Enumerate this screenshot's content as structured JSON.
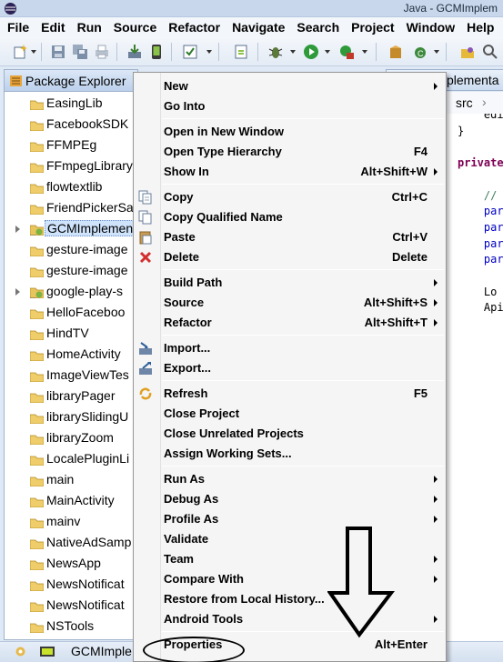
{
  "window": {
    "title": "Java - GCMImplem"
  },
  "menubar": [
    "File",
    "Edit",
    "Run",
    "Source",
    "Refactor",
    "Navigate",
    "Search",
    "Project",
    "Window",
    "Help"
  ],
  "package_explorer": {
    "tab_title": "Package Explorer",
    "items": [
      {
        "label": "EasingLib",
        "kind": "folder",
        "expandable": false
      },
      {
        "label": "FacebookSDK",
        "kind": "folder",
        "expandable": false
      },
      {
        "label": "FFMPEg",
        "kind": "folder",
        "expandable": false
      },
      {
        "label": "FFmpegLibrary",
        "kind": "folder",
        "expandable": false
      },
      {
        "label": "flowtextlib",
        "kind": "folder",
        "expandable": false
      },
      {
        "label": "FriendPickerSa",
        "kind": "folder",
        "expandable": false
      },
      {
        "label": "GCMImplemen",
        "kind": "project",
        "expandable": true,
        "selected": true
      },
      {
        "label": "gesture-image",
        "kind": "folder",
        "expandable": false
      },
      {
        "label": "gesture-image",
        "kind": "folder",
        "expandable": false
      },
      {
        "label": "google-play-s",
        "kind": "project",
        "expandable": true
      },
      {
        "label": "HelloFaceboo",
        "kind": "folder",
        "expandable": false
      },
      {
        "label": "HindTV",
        "kind": "folder",
        "expandable": false
      },
      {
        "label": "HomeActivity",
        "kind": "folder",
        "expandable": false
      },
      {
        "label": "ImageViewTes",
        "kind": "folder",
        "expandable": false
      },
      {
        "label": "libraryPager",
        "kind": "folder",
        "expandable": false
      },
      {
        "label": "librarySlidingU",
        "kind": "folder",
        "expandable": false
      },
      {
        "label": "libraryZoom",
        "kind": "folder",
        "expandable": false
      },
      {
        "label": "LocalePluginLi",
        "kind": "folder",
        "expandable": false
      },
      {
        "label": "main",
        "kind": "folder",
        "expandable": false
      },
      {
        "label": "MainActivity",
        "kind": "folder",
        "expandable": false
      },
      {
        "label": "mainv",
        "kind": "folder",
        "expandable": false
      },
      {
        "label": "NativeAdSamp",
        "kind": "folder",
        "expandable": false
      },
      {
        "label": "NewsApp",
        "kind": "folder",
        "expandable": false
      },
      {
        "label": "NewsNotificat",
        "kind": "folder",
        "expandable": false
      },
      {
        "label": "NewsNotificat",
        "kind": "folder",
        "expandable": false
      },
      {
        "label": "NSTools",
        "kind": "folder",
        "expandable": false
      }
    ]
  },
  "editor": {
    "tab_title": "plementa",
    "breadcrumb_src": "src",
    "breadcrumb_sep": "›",
    "code_lines": [
      "    edi",
      "}",
      "",
      "private",
      "",
      "    //",
      "    par",
      "    par",
      "    par",
      "    par",
      "",
      "    Lo",
      "    Api"
    ]
  },
  "status": {
    "text": "GCMImple"
  },
  "context_menu": {
    "items": [
      {
        "label": "New",
        "shortcut": "",
        "submenu": true,
        "icon": ""
      },
      {
        "label": "Go Into",
        "shortcut": "",
        "submenu": false,
        "icon": ""
      },
      {
        "sep": true
      },
      {
        "label": "Open in New Window",
        "shortcut": "",
        "submenu": false,
        "icon": ""
      },
      {
        "label": "Open Type Hierarchy",
        "shortcut": "F4",
        "submenu": false,
        "icon": ""
      },
      {
        "label": "Show In",
        "shortcut": "Alt+Shift+W",
        "submenu": true,
        "icon": ""
      },
      {
        "sep": true
      },
      {
        "label": "Copy",
        "shortcut": "Ctrl+C",
        "submenu": false,
        "icon": "copy-icon"
      },
      {
        "label": "Copy Qualified Name",
        "shortcut": "",
        "submenu": false,
        "icon": "copy-qualified-icon"
      },
      {
        "label": "Paste",
        "shortcut": "Ctrl+V",
        "submenu": false,
        "icon": "paste-icon"
      },
      {
        "label": "Delete",
        "shortcut": "Delete",
        "submenu": false,
        "icon": "delete-icon"
      },
      {
        "sep": true
      },
      {
        "label": "Build Path",
        "shortcut": "",
        "submenu": true,
        "icon": ""
      },
      {
        "label": "Source",
        "shortcut": "Alt+Shift+S",
        "submenu": true,
        "icon": ""
      },
      {
        "label": "Refactor",
        "shortcut": "Alt+Shift+T",
        "submenu": true,
        "icon": ""
      },
      {
        "sep": true
      },
      {
        "label": "Import...",
        "shortcut": "",
        "submenu": false,
        "icon": "import-icon"
      },
      {
        "label": "Export...",
        "shortcut": "",
        "submenu": false,
        "icon": "export-icon"
      },
      {
        "sep": true
      },
      {
        "label": "Refresh",
        "shortcut": "F5",
        "submenu": false,
        "icon": "refresh-icon"
      },
      {
        "label": "Close Project",
        "shortcut": "",
        "submenu": false,
        "icon": ""
      },
      {
        "label": "Close Unrelated Projects",
        "shortcut": "",
        "submenu": false,
        "icon": ""
      },
      {
        "label": "Assign Working Sets...",
        "shortcut": "",
        "submenu": false,
        "icon": ""
      },
      {
        "sep": true
      },
      {
        "label": "Run As",
        "shortcut": "",
        "submenu": true,
        "icon": ""
      },
      {
        "label": "Debug As",
        "shortcut": "",
        "submenu": true,
        "icon": ""
      },
      {
        "label": "Profile As",
        "shortcut": "",
        "submenu": true,
        "icon": ""
      },
      {
        "label": "Validate",
        "shortcut": "",
        "submenu": false,
        "icon": ""
      },
      {
        "label": "Team",
        "shortcut": "",
        "submenu": true,
        "icon": ""
      },
      {
        "label": "Compare With",
        "shortcut": "",
        "submenu": true,
        "icon": ""
      },
      {
        "label": "Restore from Local History...",
        "shortcut": "",
        "submenu": false,
        "icon": ""
      },
      {
        "label": "Android Tools",
        "shortcut": "",
        "submenu": true,
        "icon": ""
      },
      {
        "sep": true
      },
      {
        "label": "Properties",
        "shortcut": "Alt+Enter",
        "submenu": false,
        "icon": "",
        "highlighted_by_annotation": true
      }
    ]
  },
  "colors": {
    "menu_bg": "#f5f5f5",
    "selection": "#cfe3fb",
    "panel_tab": "#bcd1ec",
    "code_purple": "#7f0055",
    "code_blue": "#0000c0",
    "code_green": "#3f7f5f"
  }
}
